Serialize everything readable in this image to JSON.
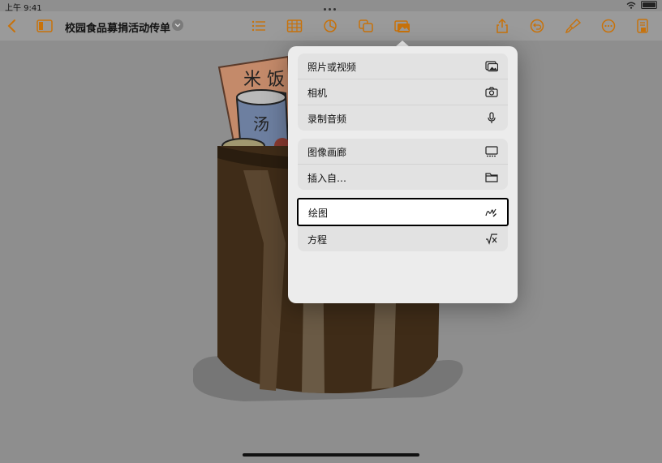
{
  "status": {
    "time": "上午 9:41"
  },
  "toolbar": {
    "doc_title": "校园食品募捐活动传单",
    "accent_color": "#c8720a",
    "icons": [
      "back-chevron-icon",
      "sidebar-icon",
      "list-icon",
      "table-icon",
      "chart-icon",
      "shape-icon",
      "media-icon",
      "share-icon",
      "undo-icon",
      "brush-icon",
      "more-icon",
      "document-icon"
    ]
  },
  "menu": {
    "group1": [
      {
        "label": "照片或视频",
        "icon": "photo-icon"
      },
      {
        "label": "相机",
        "icon": "camera-icon"
      },
      {
        "label": "录制音频",
        "icon": "microphone-icon"
      }
    ],
    "group2": [
      {
        "label": "图像画廊",
        "icon": "gallery-icon"
      },
      {
        "label": "插入自…",
        "icon": "folder-icon"
      }
    ],
    "group3": [
      {
        "label": "绘图",
        "icon": "drawing-icon",
        "selected": true
      },
      {
        "label": "方程",
        "icon": "equation-icon"
      }
    ]
  }
}
